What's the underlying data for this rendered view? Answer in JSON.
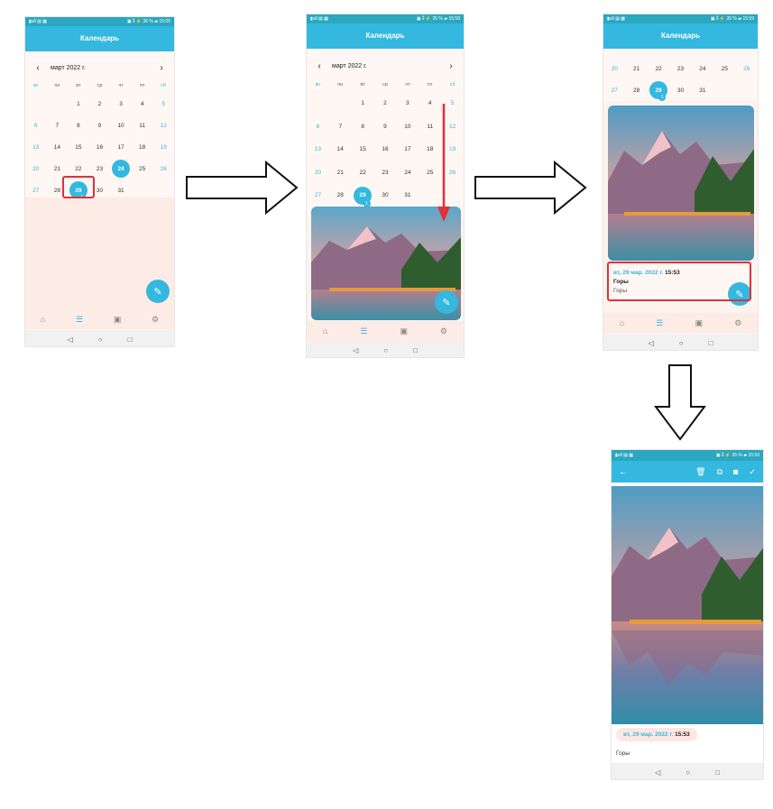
{
  "status": {
    "left": "▮ull ▤ ▦",
    "right_1": "▣ ⁑ ⚡ 36 % ▰ 15:05",
    "right_2": "▣ ⁑ ⚡ 35 % ▰ 15:58",
    "right_3": "▣ ⁑ ⚡ 35 % ▰ 15:59"
  },
  "app_title": "Календарь",
  "month_label": "март 2022 г.",
  "weekdays": [
    "вс",
    "пн",
    "вт",
    "ср",
    "чт",
    "пт",
    "сб"
  ],
  "weeks": [
    [
      "",
      "",
      "1",
      "2",
      "3",
      "4",
      "5"
    ],
    [
      "6",
      "7",
      "8",
      "9",
      "10",
      "11",
      "12"
    ],
    [
      "13",
      "14",
      "15",
      "16",
      "17",
      "18",
      "19"
    ],
    [
      "20",
      "21",
      "22",
      "23",
      "24",
      "25",
      "26"
    ],
    [
      "27",
      "28",
      "29",
      "30",
      "31",
      "",
      ""
    ]
  ],
  "weeks_screen3": [
    [
      "20",
      "21",
      "22",
      "23",
      "24",
      "25",
      "26"
    ],
    [
      "27",
      "28",
      "29",
      "30",
      "31",
      "",
      ""
    ]
  ],
  "today": "24",
  "selected_day": "29",
  "selected_count": "1",
  "note": {
    "date": "вт, 29 мар. 2022 г.",
    "time": "15:53",
    "title": "Горы",
    "body": "Горы"
  },
  "fab_icon": "pencil-icon",
  "nav_icons": [
    "home-icon",
    "list-icon",
    "image-icon",
    "gear-icon"
  ],
  "sysnav": {
    "back": "◁",
    "home": "○",
    "recent": "□"
  },
  "detail_icons": [
    "back-arrow-icon",
    "trash-icon",
    "copy-icon",
    "camera-icon",
    "check-icon"
  ],
  "colors": {
    "accent": "#34b8df",
    "highlight": "#e0303a",
    "surface": "#fdf3ee"
  }
}
